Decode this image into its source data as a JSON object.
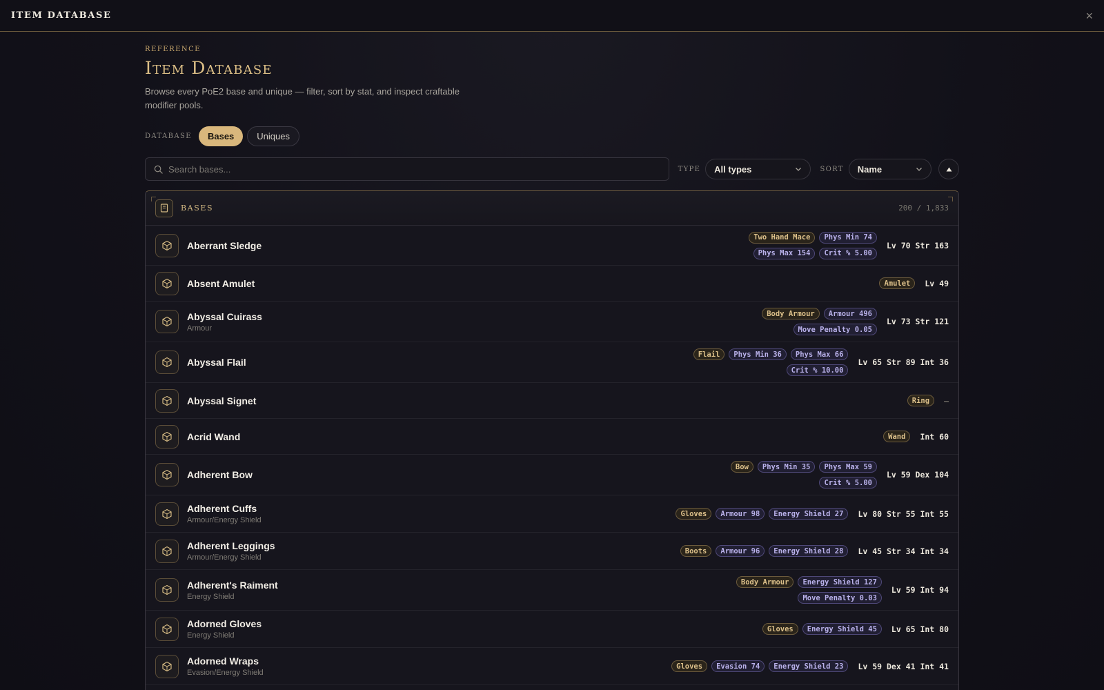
{
  "window": {
    "title": "ITEM DATABASE",
    "close_label": "×"
  },
  "header": {
    "eyebrow": "REFERENCE",
    "title": "Item Database",
    "subtitle": "Browse every PoE2 base and unique — filter, sort by stat, and inspect craftable modifier pools."
  },
  "database": {
    "label": "DATABASE",
    "tabs": [
      "Bases",
      "Uniques"
    ],
    "active": "Bases"
  },
  "filters": {
    "search_placeholder": "Search bases...",
    "type_label": "TYPE",
    "type_value": "All types",
    "sort_label": "SORT",
    "sort_value": "Name",
    "sort_direction": "ascending"
  },
  "panel": {
    "title": "BASES",
    "count": "200 / 1,833"
  },
  "colors": {
    "accent": "#d9b77c",
    "stat_tag": "#b9b1ea",
    "category_tag": "#dcc08a"
  },
  "items": [
    {
      "name": "Aberrant Sledge",
      "sub": "",
      "tags": [
        [
          "Two Hand Mace",
          "cat"
        ],
        [
          "Phys Min 74",
          "stat"
        ],
        [
          "Phys Max 154",
          "stat"
        ],
        [
          "Crit % 5.00",
          "stat"
        ]
      ],
      "req": "Lv 70 Str 163",
      "h": 58,
      "tagw": 200
    },
    {
      "name": "Absent Amulet",
      "sub": "",
      "tags": [
        [
          "Amulet",
          "cat"
        ]
      ],
      "req": "Lv 49",
      "h": 52,
      "tagw": 200
    },
    {
      "name": "Abyssal Cuirass",
      "sub": "Armour",
      "tags": [
        [
          "Body Armour",
          "cat"
        ],
        [
          "Armour 496",
          "stat"
        ],
        [
          "Move Penalty 0.05",
          "stat"
        ]
      ],
      "req": "Lv 73 Str 121",
      "h": 59,
      "tagw": 200
    },
    {
      "name": "Abyssal Flail",
      "sub": "",
      "tags": [
        [
          "Flail",
          "cat"
        ],
        [
          "Phys Min 36",
          "stat"
        ],
        [
          "Phys Max 66",
          "stat"
        ],
        [
          "Crit % 10.00",
          "stat"
        ]
      ],
      "req": "Lv 65 Str 89 Int 36",
      "h": 59,
      "tagw": 240
    },
    {
      "name": "Abyssal Signet",
      "sub": "",
      "tags": [
        [
          "Ring",
          "cat"
        ]
      ],
      "req": "—",
      "h": 52,
      "tagw": 200
    },
    {
      "name": "Acrid Wand",
      "sub": "",
      "tags": [
        [
          "Wand",
          "cat"
        ]
      ],
      "req": "Int 60",
      "h": 52,
      "tagw": 200
    },
    {
      "name": "Adherent Bow",
      "sub": "",
      "tags": [
        [
          "Bow",
          "cat"
        ],
        [
          "Phys Min 35",
          "stat"
        ],
        [
          "Phys Max 59",
          "stat"
        ],
        [
          "Crit % 5.00",
          "stat"
        ]
      ],
      "req": "Lv 59 Dex 104",
      "h": 59,
      "tagw": 220
    },
    {
      "name": "Adherent Cuffs",
      "sub": "Armour/Energy Shield",
      "tags": [
        [
          "Gloves",
          "cat"
        ],
        [
          "Armour 98",
          "stat"
        ],
        [
          "Energy Shield 27",
          "stat"
        ]
      ],
      "req": "Lv 80 Str 55 Int 55",
      "h": 54,
      "tagw": 400
    },
    {
      "name": "Adherent Leggings",
      "sub": "Armour/Energy Shield",
      "tags": [
        [
          "Boots",
          "cat"
        ],
        [
          "Armour 96",
          "stat"
        ],
        [
          "Energy Shield 28",
          "stat"
        ]
      ],
      "req": "Lv 45 Str 34 Int 34",
      "h": 54,
      "tagw": 400
    },
    {
      "name": "Adherent's Raiment",
      "sub": "Energy Shield",
      "tags": [
        [
          "Body Armour",
          "cat"
        ],
        [
          "Energy Shield 127",
          "stat"
        ],
        [
          "Move Penalty 0.03",
          "stat"
        ]
      ],
      "req": "Lv 59 Int 94",
      "h": 59,
      "tagw": 230
    },
    {
      "name": "Adorned Gloves",
      "sub": "Energy Shield",
      "tags": [
        [
          "Gloves",
          "cat"
        ],
        [
          "Energy Shield 45",
          "stat"
        ]
      ],
      "req": "Lv 65 Int 80",
      "h": 54,
      "tagw": 400
    },
    {
      "name": "Adorned Wraps",
      "sub": "Evasion/Energy Shield",
      "tags": [
        [
          "Gloves",
          "cat"
        ],
        [
          "Evasion 74",
          "stat"
        ],
        [
          "Energy Shield 23",
          "stat"
        ]
      ],
      "req": "Lv 59 Dex 41 Int 41",
      "h": 54,
      "tagw": 400
    }
  ]
}
